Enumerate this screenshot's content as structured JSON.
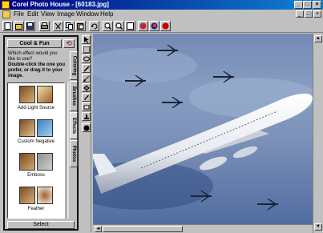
{
  "window": {
    "title": "Corel Photo House - [60183.jpg]",
    "controls": [
      "_",
      "□",
      "×"
    ]
  },
  "menu": [
    "File",
    "Edit",
    "View",
    "Image",
    "Window",
    "Help"
  ],
  "doc_controls": [
    "_",
    "□",
    "×"
  ],
  "toolbar_icons": [
    "new-icon",
    "open-icon",
    "save-icon",
    "print-icon",
    "cut-icon",
    "copy-icon",
    "paste-icon",
    "undo-icon",
    "zoom-in-icon",
    "zoom-out-icon",
    "fit-icon",
    "effects-icon",
    "color-icon",
    "stop-icon"
  ],
  "side_tool_icons": [
    "pointer-icon",
    "rect-select-icon",
    "lasso-icon",
    "pen-icon",
    "brush-icon",
    "fill-icon",
    "smudge-icon",
    "eraser-icon",
    "stamp-icon",
    "color-swatch-icon"
  ],
  "panel": {
    "title": "Cool & Fun",
    "undo_symbol": "⟲",
    "instructions_1": "Which effect would you like to use?",
    "instructions_2": "Double-click the one you prefer, or drag it to your image.",
    "effects": [
      {
        "label": "Add Light Source"
      },
      {
        "label": "Custom Negative"
      },
      {
        "label": "Emboss"
      },
      {
        "label": "Feather"
      }
    ],
    "tabs": [
      "Coloring",
      "Brushes",
      "Effects",
      "Photos"
    ],
    "select_label": "Select"
  },
  "scroll_arrows": {
    "left": "◄",
    "up": "▲",
    "down": "▼"
  }
}
